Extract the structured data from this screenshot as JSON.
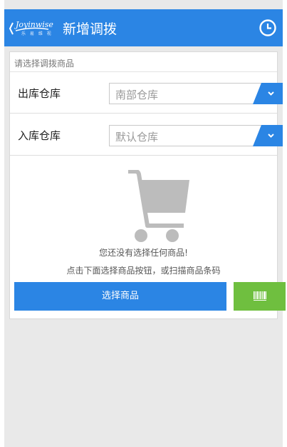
{
  "header": {
    "logo_text": "Joyinwise",
    "logo_sub": "乐 易 维 视",
    "title": "新增调拨",
    "back_icon": "chevron-left-icon",
    "history_icon": "clock-icon",
    "color": "#2b85e4"
  },
  "form": {
    "hint": "请选择调拨商品",
    "out_warehouse": {
      "label": "出库仓库",
      "value": "南部仓库"
    },
    "in_warehouse": {
      "label": "入库仓库",
      "value": "默认仓库"
    }
  },
  "empty_state": {
    "icon": "shopping-cart-icon",
    "line1": "您还没有选择任何商品!",
    "line2": "点击下面选择商品按钮，或扫描商品条码"
  },
  "actions": {
    "select_goods": "选择商品",
    "scan_icon": "barcode-icon",
    "select_color": "#2b85e4",
    "scan_color": "#6fbf3f"
  }
}
